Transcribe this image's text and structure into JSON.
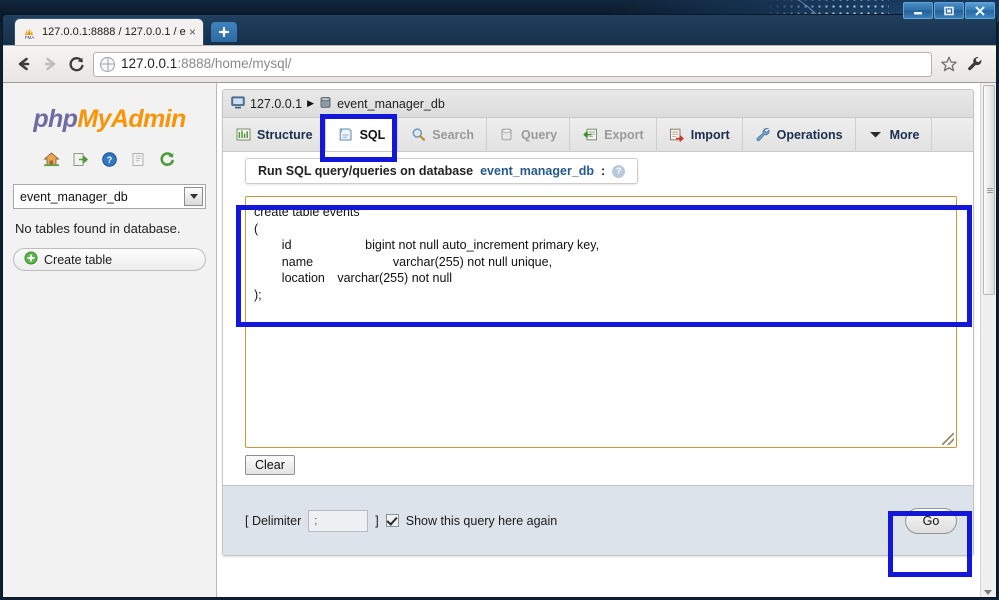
{
  "window": {
    "buttons": {
      "minimize": "minimize",
      "maximize": "maximize",
      "close": "close"
    }
  },
  "browser": {
    "tab": {
      "title": "127.0.0.1:8888 / 127.0.0.1 / e",
      "favicon": "phpmyadmin-favicon",
      "close_label": "×"
    },
    "new_tab_label": "+",
    "nav": {
      "back": "←",
      "forward": "→",
      "reload": "⟳",
      "url_host": "127.0.0.1",
      "url_rest": ":8888/home/mysql/",
      "bookmark_icon": "star-icon",
      "menu_icon": "wrench-icon"
    }
  },
  "sidebar": {
    "logo": {
      "part1": "php",
      "part2": "My",
      "part3": "Admin"
    },
    "icons": [
      {
        "name": "home-icon",
        "glyph": "⌂"
      },
      {
        "name": "logout-icon",
        "glyph": "↪"
      },
      {
        "name": "help-icon",
        "glyph": "?"
      },
      {
        "name": "documentation-icon",
        "glyph": "▤"
      },
      {
        "name": "reload-icon",
        "glyph": "↻"
      }
    ],
    "database_select": {
      "value": "event_manager_db"
    },
    "no_tables_text": "No tables found in database.",
    "create_table_label": "Create table"
  },
  "main": {
    "breadcrumb": {
      "server": "127.0.0.1",
      "separator": "▶",
      "database": "event_manager_db"
    },
    "tabs": [
      {
        "label": "Structure",
        "icon": "structure-icon",
        "state": "normal"
      },
      {
        "label": "SQL",
        "icon": "sql-icon",
        "state": "active"
      },
      {
        "label": "Search",
        "icon": "search-icon",
        "state": "disabled"
      },
      {
        "label": "Query",
        "icon": "query-icon",
        "state": "disabled"
      },
      {
        "label": "Export",
        "icon": "export-icon",
        "state": "disabled"
      },
      {
        "label": "Import",
        "icon": "import-icon",
        "state": "normal"
      },
      {
        "label": "Operations",
        "icon": "operations-icon",
        "state": "normal"
      },
      {
        "label": "More",
        "icon": "chevron-down-icon",
        "state": "normal"
      }
    ],
    "panel": {
      "run_header_prefix": "Run SQL query/queries on database ",
      "run_header_db": "event_manager_db",
      "run_header_suffix": ":",
      "help_icon_label": "?",
      "sql_query": "create table events\n(\n\tid\t\t\tbigint not null auto_increment primary key,\n\tname\t\t\tvarchar(255) not null unique,\n\tlocation\tvarchar(255) not null\n);",
      "clear_label": "Clear",
      "delimiter_label_open": "[ Delimiter",
      "delimiter_value": ";",
      "delimiter_label_close": "]",
      "show_query_label": "Show this query here again",
      "show_query_checked": true,
      "go_label": "Go"
    }
  },
  "annotations": {
    "accent_color": "#1318d8",
    "boxes": [
      {
        "name": "sql-tab-highlight"
      },
      {
        "name": "sql-textarea-highlight"
      },
      {
        "name": "go-button-highlight"
      }
    ]
  }
}
